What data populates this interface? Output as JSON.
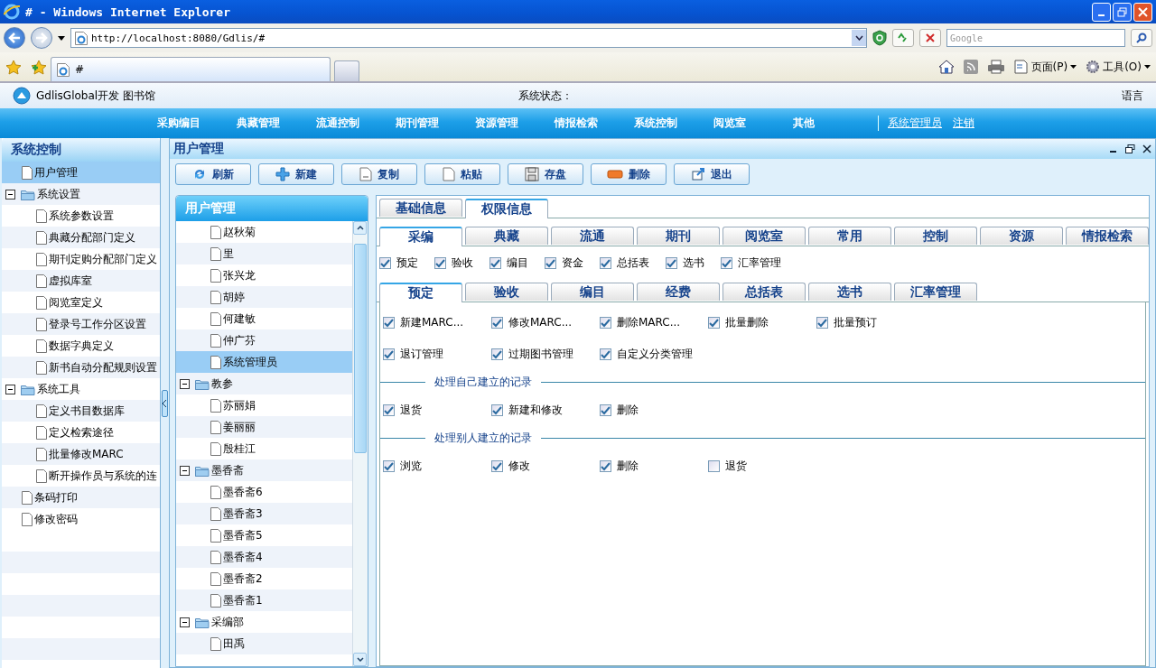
{
  "browser": {
    "title": "# - Windows Internet Explorer",
    "address": "http://localhost:8080/Gdlis/#",
    "search_placeholder": "Google",
    "tab_title": "#",
    "commands": [
      {
        "label": "页面(P)",
        "kind": "page"
      },
      {
        "label": "工具(O)",
        "kind": "tools"
      }
    ]
  },
  "app": {
    "title": "GdlisGlobal开发 图书馆",
    "status_label": "系统状态：",
    "language": "语言",
    "menu": [
      "采购编目",
      "典藏管理",
      "流通控制",
      "期刊管理",
      "资源管理",
      "情报检索",
      "系统控制",
      "阅览室",
      "其他"
    ],
    "user": "系统管理员",
    "logout": "注销"
  },
  "sidebar": {
    "title": "系统控制",
    "items": [
      {
        "label": "用户管理",
        "selected": true
      },
      {
        "label": "系统设置",
        "selected": false,
        "expanded": true,
        "children": [
          {
            "label": "系统参数设置",
            "selected": false
          },
          {
            "label": "典藏分配部门定义",
            "selected": false
          },
          {
            "label": "期刊定购分配部门定义",
            "selected": false
          },
          {
            "label": "虚拟库室",
            "selected": false
          },
          {
            "label": "阅览室定义",
            "selected": false
          },
          {
            "label": "登录号工作分区设置",
            "selected": false
          },
          {
            "label": "数据字典定义",
            "selected": false
          },
          {
            "label": "新书自动分配规则设置",
            "selected": false
          }
        ]
      },
      {
        "label": "系统工具",
        "selected": false,
        "expanded": true,
        "children": [
          {
            "label": "定义书目数据库",
            "selected": false
          },
          {
            "label": "定义检索途径",
            "selected": false
          },
          {
            "label": "批量修改MARC",
            "selected": false
          },
          {
            "label": "断开操作员与系统的连",
            "selected": false
          }
        ]
      },
      {
        "label": "条码打印",
        "selected": false
      },
      {
        "label": "修改密码",
        "selected": false
      }
    ]
  },
  "panel": {
    "title": "用户管理",
    "toolbar": [
      {
        "label": "刷新",
        "kind": "refresh"
      },
      {
        "label": "新建",
        "kind": "add"
      },
      {
        "label": "复制",
        "kind": "copy"
      },
      {
        "label": "粘贴",
        "kind": "paste"
      },
      {
        "label": "存盘",
        "kind": "save"
      },
      {
        "label": "删除",
        "kind": "delete"
      },
      {
        "label": "退出",
        "kind": "exit"
      }
    ]
  },
  "user_tree": {
    "title": "用户管理",
    "scrolled_group_children": [
      {
        "label": "赵秋菊",
        "selected": false
      },
      {
        "label": "里",
        "selected": false
      },
      {
        "label": "张兴龙",
        "selected": false
      },
      {
        "label": "胡婷",
        "selected": false
      },
      {
        "label": "何建敏",
        "selected": false
      },
      {
        "label": "仲广芬",
        "selected": false
      },
      {
        "label": "系统管理员",
        "selected": true
      }
    ],
    "nodes": [
      {
        "label": "教参",
        "selected": false,
        "expanded": true,
        "children": [
          {
            "label": "苏丽娟",
            "selected": false
          },
          {
            "label": "姜丽丽",
            "selected": false
          },
          {
            "label": "殷桂江",
            "selected": false
          }
        ]
      },
      {
        "label": "墨香斋",
        "selected": false,
        "expanded": true,
        "children": [
          {
            "label": "墨香斋6",
            "selected": false
          },
          {
            "label": "墨香斋3",
            "selected": false
          },
          {
            "label": "墨香斋5",
            "selected": false
          },
          {
            "label": "墨香斋4",
            "selected": false
          },
          {
            "label": "墨香斋2",
            "selected": false
          },
          {
            "label": "墨香斋1",
            "selected": false
          }
        ]
      },
      {
        "label": "采编部",
        "selected": false,
        "expanded": true,
        "children": [
          {
            "label": "田禹",
            "selected": false
          }
        ]
      }
    ]
  },
  "permissions": {
    "tabs": [
      {
        "label": "基础信息",
        "selected": false
      },
      {
        "label": "权限信息",
        "selected": true
      }
    ],
    "module_tabs": [
      {
        "label": "采编",
        "selected": true
      },
      {
        "label": "典藏",
        "selected": false
      },
      {
        "label": "流通",
        "selected": false
      },
      {
        "label": "期刊",
        "selected": false
      },
      {
        "label": "阅览室",
        "selected": false
      },
      {
        "label": "常用",
        "selected": false
      },
      {
        "label": "控制",
        "selected": false
      },
      {
        "label": "资源",
        "selected": false
      },
      {
        "label": "情报检索",
        "selected": false
      }
    ],
    "module_checks": [
      {
        "label": "预定",
        "checked": true
      },
      {
        "label": "验收",
        "checked": true
      },
      {
        "label": "编目",
        "checked": true
      },
      {
        "label": "资金",
        "checked": true
      },
      {
        "label": "总括表",
        "checked": true
      },
      {
        "label": "选书",
        "checked": true
      },
      {
        "label": "汇率管理",
        "checked": true
      }
    ],
    "sub_tabs": [
      {
        "label": "预定",
        "selected": true
      },
      {
        "label": "验收",
        "selected": false
      },
      {
        "label": "编目",
        "selected": false
      },
      {
        "label": "经费",
        "selected": false
      },
      {
        "label": "总括表",
        "selected": false
      },
      {
        "label": "选书",
        "selected": false
      },
      {
        "label": "汇率管理",
        "selected": false
      }
    ],
    "rights": [
      {
        "label": "新建MARC...",
        "checked": true
      },
      {
        "label": "修改MARC...",
        "checked": true
      },
      {
        "label": "删除MARC...",
        "checked": true
      },
      {
        "label": "批量删除",
        "checked": true
      },
      {
        "label": "批量预订",
        "checked": true
      },
      {
        "label": "退订管理",
        "checked": true
      },
      {
        "label": "过期图书管理",
        "checked": true
      },
      {
        "label": "自定义分类管理",
        "checked": true
      }
    ],
    "groups": [
      {
        "title": "处理自己建立的记录",
        "items": [
          {
            "label": "退货",
            "checked": true
          },
          {
            "label": "新建和修改",
            "checked": true
          },
          {
            "label": "删除",
            "checked": true
          }
        ]
      },
      {
        "title": "处理别人建立的记录",
        "items": [
          {
            "label": "浏览",
            "checked": true
          },
          {
            "label": "修改",
            "checked": true
          },
          {
            "label": "删除",
            "checked": true
          },
          {
            "label": "退货",
            "checked": false
          }
        ]
      }
    ]
  }
}
